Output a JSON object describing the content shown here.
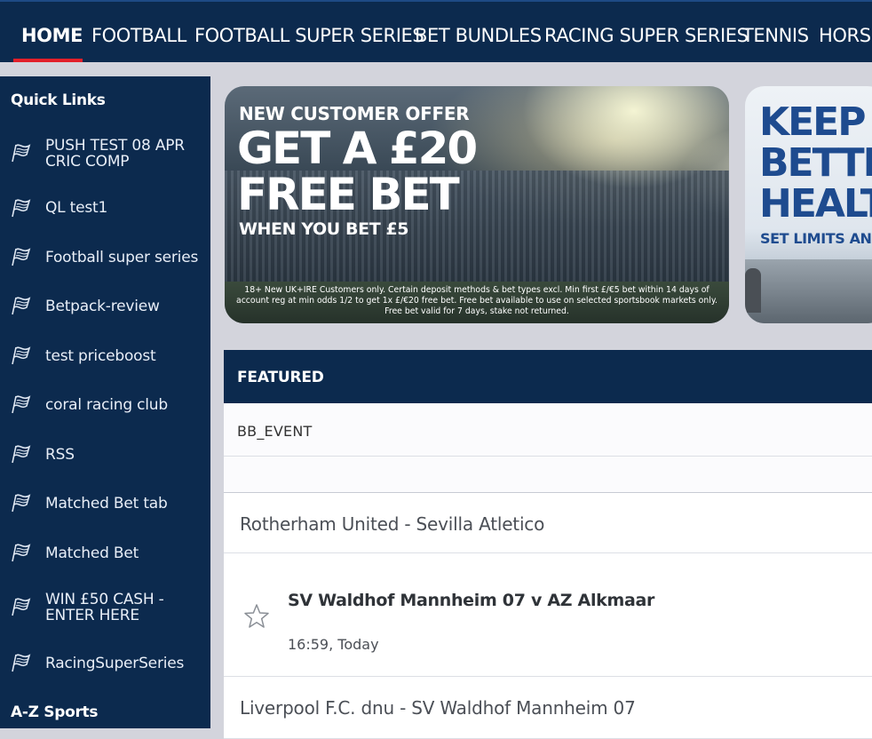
{
  "topnav": {
    "tabs": [
      {
        "label": "HOME",
        "active": true
      },
      {
        "label": "FOOTBALL",
        "active": false
      },
      {
        "label": "FOOTBALL SUPER SERIES",
        "active": false
      },
      {
        "label": "BET BUNDLES",
        "active": false
      },
      {
        "label": "RACING SUPER SERIES",
        "active": false
      },
      {
        "label": "TENNIS",
        "active": false
      },
      {
        "label": "HORSE",
        "active": false
      }
    ],
    "active_indicator_color": "#e3202a"
  },
  "sidebar": {
    "quick_links_title": "Quick Links",
    "items": [
      {
        "label": "PUSH TEST 08 APR CRIC COMP",
        "icon": "flag-icon"
      },
      {
        "label": "QL test1",
        "icon": "flag-icon"
      },
      {
        "label": "Football super series",
        "icon": "flag-icon"
      },
      {
        "label": "Betpack-review",
        "icon": "flag-icon"
      },
      {
        "label": "test priceboost",
        "icon": "flag-icon"
      },
      {
        "label": "coral racing club",
        "icon": "flag-icon"
      },
      {
        "label": "RSS",
        "icon": "flag-icon"
      },
      {
        "label": "Matched Bet tab",
        "icon": "flag-icon"
      },
      {
        "label": "Matched Bet",
        "icon": "flag-icon"
      },
      {
        "label": "WIN £50 CASH - ENTER HERE",
        "icon": "flag-icon"
      },
      {
        "label": "RacingSuperSeries",
        "icon": "flag-icon"
      }
    ],
    "az_title": "A-Z Sports"
  },
  "banners": {
    "offer": {
      "kicker": "NEW CUSTOMER OFFER",
      "headline_1": "GET A £20",
      "headline_2": "FREE BET",
      "subline": "WHEN YOU BET £5",
      "terms": "18+ New UK+IRE Customers only. Certain deposit methods & bet types excl. Min first £/€5 bet within 14 days of account reg at min odds 1/2 to get 1x £/€20 free bet. Free bet available to use on selected sportsbook markets only. Free bet valid for 7 days, stake not returned."
    },
    "safer": {
      "line_1": "KEEP Y",
      "line_2": "BETTI",
      "line_3": "HEALT",
      "subline": "SET LIMITS AND"
    }
  },
  "featured": {
    "title": "FEATURED",
    "bb_event_label": "BB_EVENT",
    "match_1": "Rotherham United - Sevilla Atletico",
    "event": {
      "name": "SV Waldhof Mannheim 07 v AZ Alkmaar",
      "time": "16:59, Today"
    },
    "match_2": "Liverpool F.C. dnu - SV Waldhof Mannheim 07"
  },
  "colors": {
    "navy": "#0c2a4e",
    "page_bg": "#d3d4dc",
    "accent_red": "#e3202a",
    "banner_blue": "#1e4b8f"
  }
}
